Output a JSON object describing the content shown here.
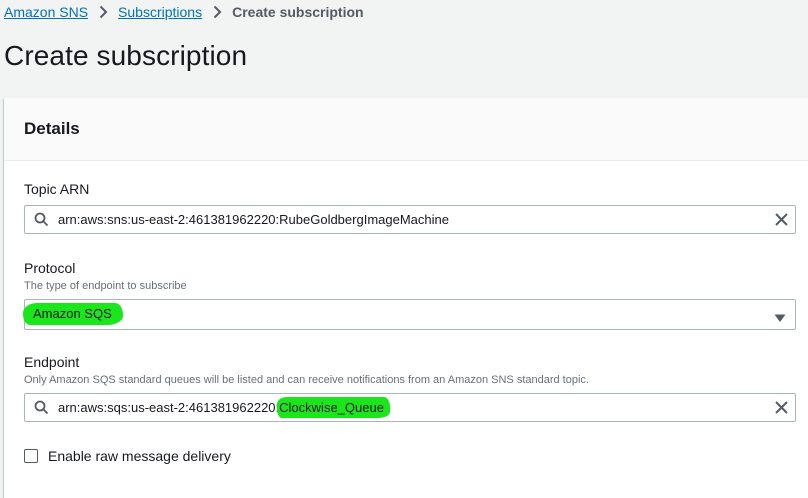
{
  "breadcrumb": {
    "items": [
      "Amazon SNS",
      "Subscriptions"
    ],
    "current": "Create subscription"
  },
  "page": {
    "title": "Create subscription"
  },
  "details": {
    "title": "Details",
    "topic_arn": {
      "label": "Topic ARN",
      "value": "arn:aws:sns:us-east-2:461381962220:RubeGoldbergImageMachine"
    },
    "protocol": {
      "label": "Protocol",
      "description": "The type of endpoint to subscribe",
      "value": "Amazon SQS"
    },
    "endpoint": {
      "label": "Endpoint",
      "description": "Only Amazon SQS standard queues will be listed and can receive notifications from an Amazon SNS standard topic.",
      "value_prefix": "arn:aws:sqs:us-east-2:461381962220:",
      "value_highlight": "Clockwise_Queue"
    },
    "raw_delivery": {
      "label": "Enable raw message delivery",
      "checked": false
    }
  },
  "colors": {
    "link": "#0073bb",
    "highlight": "#1be51b",
    "page_bg": "#f2f3f3",
    "border": "#aab7b8"
  },
  "icons": [
    "chevron-right-icon",
    "search-icon",
    "close-icon",
    "caret-down-icon"
  ]
}
